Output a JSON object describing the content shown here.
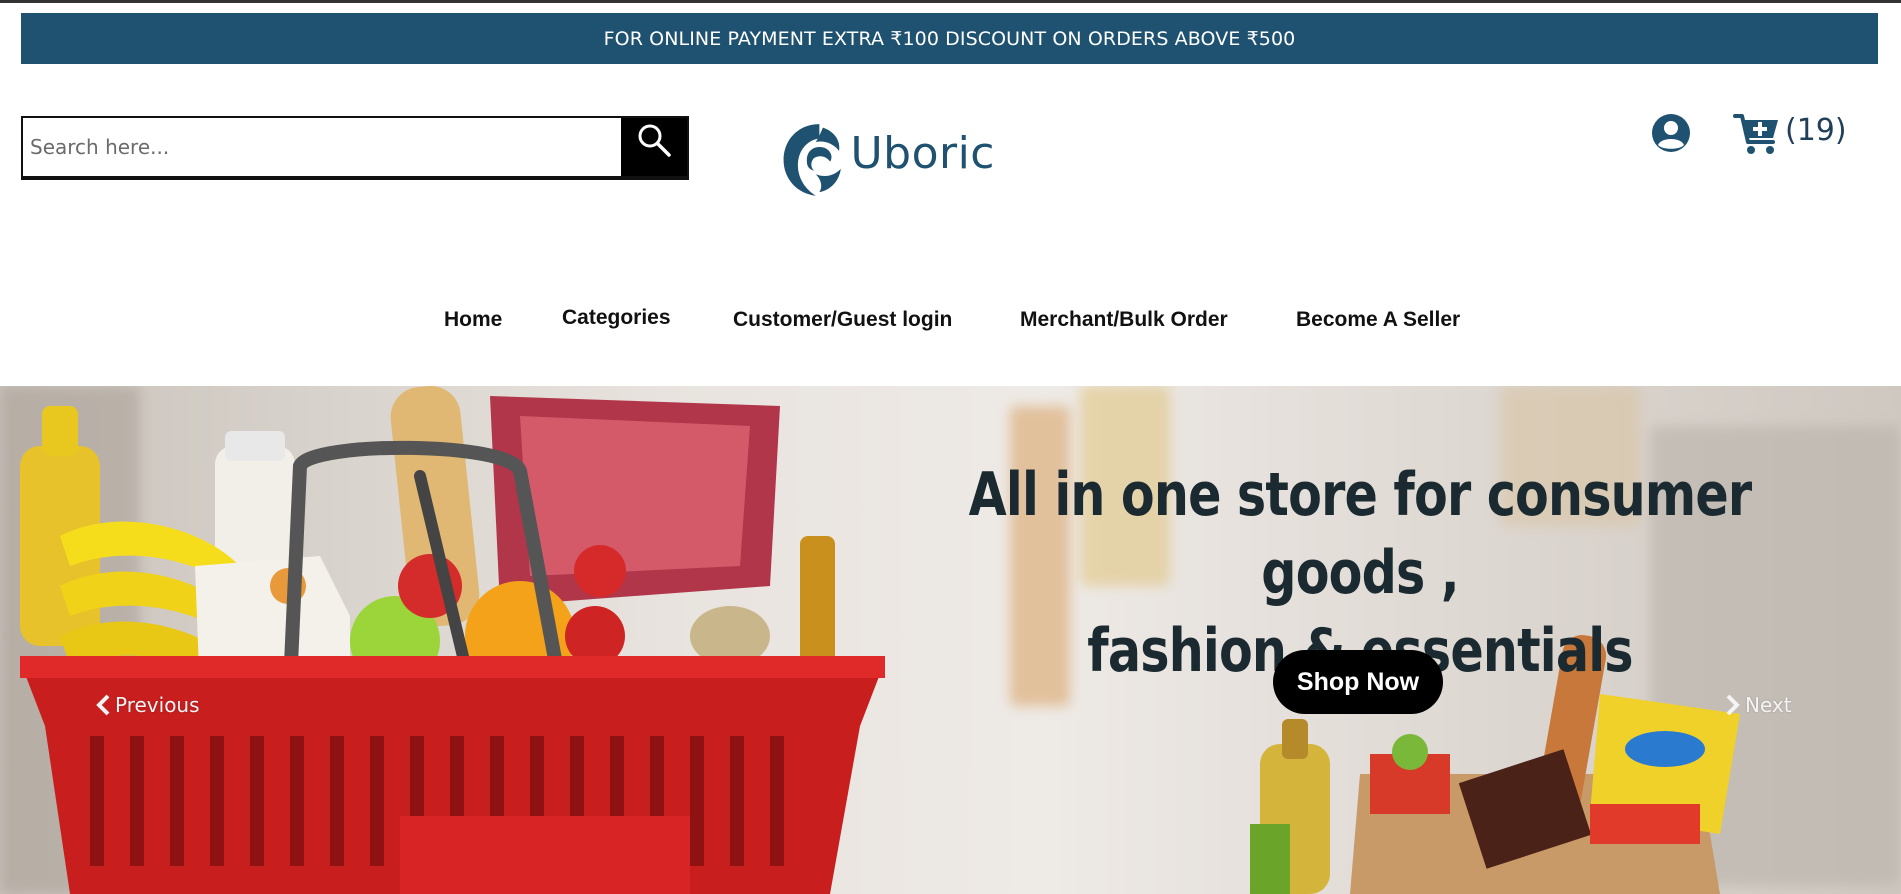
{
  "promo": {
    "text": "FOR ONLINE PAYMENT EXTRA ₹100 DISCOUNT ON ORDERS ABOVE ₹500"
  },
  "search": {
    "placeholder": "Search here..."
  },
  "brand": {
    "name": "Uboric",
    "color": "#1f5270"
  },
  "header": {
    "cart_count": "(19)"
  },
  "nav": {
    "items": [
      {
        "label": "Home"
      },
      {
        "label": "Categories"
      },
      {
        "label": "Customer/Guest login"
      },
      {
        "label": "Merchant/Bulk Order"
      },
      {
        "label": "Become A Seller"
      }
    ]
  },
  "hero": {
    "heading_line1": "All in one store for consumer goods ,",
    "heading_line2": "fashion & essentials",
    "cta": "Shop Now",
    "prev_label": "Previous",
    "next_label": "Next"
  },
  "colors": {
    "promo_bg": "#1f5270",
    "accent": "#1f5270",
    "button": "#000000"
  },
  "icons": [
    "search-icon",
    "account-icon",
    "cart-plus-icon",
    "chevron-left-icon",
    "chevron-right-icon",
    "logo-swirl-icon"
  ]
}
